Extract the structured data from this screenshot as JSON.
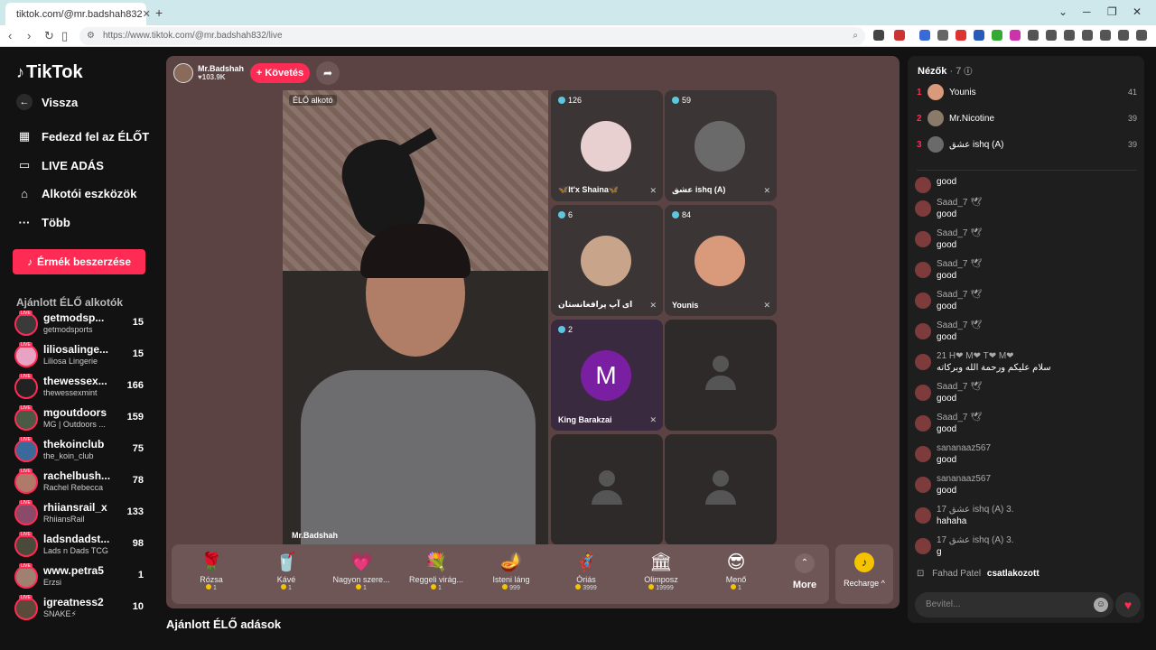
{
  "browser": {
    "tab_title": "tiktok.com/@mr.badshah832",
    "new_tab": "+",
    "url": "https://www.tiktok.com/@mr.badshah832/live"
  },
  "sidebar": {
    "logo": "TikTok",
    "back": "Vissza",
    "items": [
      {
        "label": "Fedezd fel az ÉLŐT",
        "icon": "calendar-icon"
      },
      {
        "label": "LIVE ADÁS",
        "icon": "camera-icon"
      },
      {
        "label": "Alkotói eszközök",
        "icon": "creator-tools-icon"
      },
      {
        "label": "Több",
        "icon": "more-dots-icon"
      }
    ],
    "coins_button": "Érmék beszerzése",
    "recommended_title": "Ajánlott ÉLŐ alkotók",
    "creators": [
      {
        "name": "getmodsp...",
        "sub": "getmodsports",
        "count": "15",
        "color": "#3a3a3a"
      },
      {
        "name": "liliosalinge...",
        "sub": "Liliosa Lingerie",
        "count": "15",
        "color": "#e8a3c4"
      },
      {
        "name": "thewessex...",
        "sub": "thewessexmint",
        "count": "166",
        "color": "#222222"
      },
      {
        "name": "mgoutdoors",
        "sub": "MG | Outdoors ...",
        "count": "159",
        "color": "#4a5a44"
      },
      {
        "name": "thekoinclub",
        "sub": "the_koin_club",
        "count": "75",
        "color": "#3a6a9a"
      },
      {
        "name": "rachelbush...",
        "sub": "Rachel Rebecca",
        "count": "78",
        "color": "#b07a6a"
      },
      {
        "name": "rhiiansrail_x",
        "sub": "RhiiansRail",
        "count": "133",
        "color": "#8a4a6a"
      },
      {
        "name": "ladsndadst...",
        "sub": "Lads n Dads TCG",
        "count": "98",
        "color": "#4a4a3a"
      },
      {
        "name": "www.petra5",
        "sub": "Erzsi",
        "count": "1",
        "color": "#a08070"
      },
      {
        "name": "igreatness2",
        "sub": "SNAKE⚡",
        "count": "10",
        "color": "#5a4a3a"
      }
    ]
  },
  "stream": {
    "host_name": "Mr.Badshah",
    "host_likes": "♥103.9K",
    "follow": "+ Követés",
    "live_tag": "ÉLŐ alkotó",
    "host_label": "Mr.Badshah",
    "guests": [
      {
        "count": "126",
        "name": "🦋It'x Shaina🦋",
        "color": "#e8d0d0"
      },
      {
        "count": "59",
        "name": "عشق ishq (A)",
        "color": "#6a6a6a"
      },
      {
        "count": "6",
        "name": "ای آپ پرافغانستان",
        "color": "#c8a48a"
      },
      {
        "count": "84",
        "name": "Younis",
        "color": "#d89a7a"
      },
      {
        "count": "2",
        "name": "King Barakzai",
        "initial": "M"
      }
    ]
  },
  "gifts": [
    {
      "label": "Rózsa",
      "price": "1",
      "icon": "🌹"
    },
    {
      "label": "Kávé",
      "price": "1",
      "icon": "🥤"
    },
    {
      "label": "Nagyon szere...",
      "price": "1",
      "icon": "💗"
    },
    {
      "label": "Reggeli virág...",
      "price": "1",
      "icon": "💐"
    },
    {
      "label": "Isteni láng",
      "price": "999",
      "icon": "🪔"
    },
    {
      "label": "Óriás",
      "price": "3999",
      "icon": "🦸"
    },
    {
      "label": "Olimposz",
      "price": "19999",
      "icon": "🏛"
    },
    {
      "label": "Menő",
      "price": "1",
      "icon": "😎"
    }
  ],
  "gift_more": "More",
  "recharge": "Recharge ^",
  "recommended_live": "Ajánlott ÉLŐ adások",
  "chat": {
    "viewers_label": "Nézők",
    "viewers_count": "· 7",
    "top_viewers": [
      {
        "rank": "1",
        "name": "Younis",
        "value": "41",
        "color": "#d89a7a"
      },
      {
        "rank": "2",
        "name": "Mr.Nicotine",
        "value": "39",
        "color": "#8a7a6a"
      },
      {
        "rank": "3",
        "name": "عشق ishq (A)",
        "value": "39",
        "color": "#6a6a6a"
      }
    ],
    "messages": [
      {
        "user": "",
        "text": "good"
      },
      {
        "user": "Saad_7 🕊",
        "text": "good"
      },
      {
        "user": "Saad_7 🕊",
        "text": "good"
      },
      {
        "user": "Saad_7 🕊",
        "text": "good"
      },
      {
        "user": "Saad_7 🕊",
        "text": "good"
      },
      {
        "user": "Saad_7 🕊",
        "text": "good"
      },
      {
        "user": "21 H❤ M❤ T❤ M❤",
        "text": "سلام علیکم ورحمة الله وبرکاته"
      },
      {
        "user": "Saad_7 🕊",
        "text": "good"
      },
      {
        "user": "Saad_7 🕊",
        "text": "good"
      },
      {
        "user": "sananaaz567",
        "text": "good"
      },
      {
        "user": "sananaaz567",
        "text": "good"
      },
      {
        "user": "17 عشق ishq (A) 3.",
        "text": "hahaha"
      },
      {
        "user": "17 عشق ishq (A) 3.",
        "text": "g"
      }
    ],
    "joined_user": "Fahad Patel",
    "joined_text": "csatlakozott",
    "input_placeholder": "Bevitel..."
  }
}
